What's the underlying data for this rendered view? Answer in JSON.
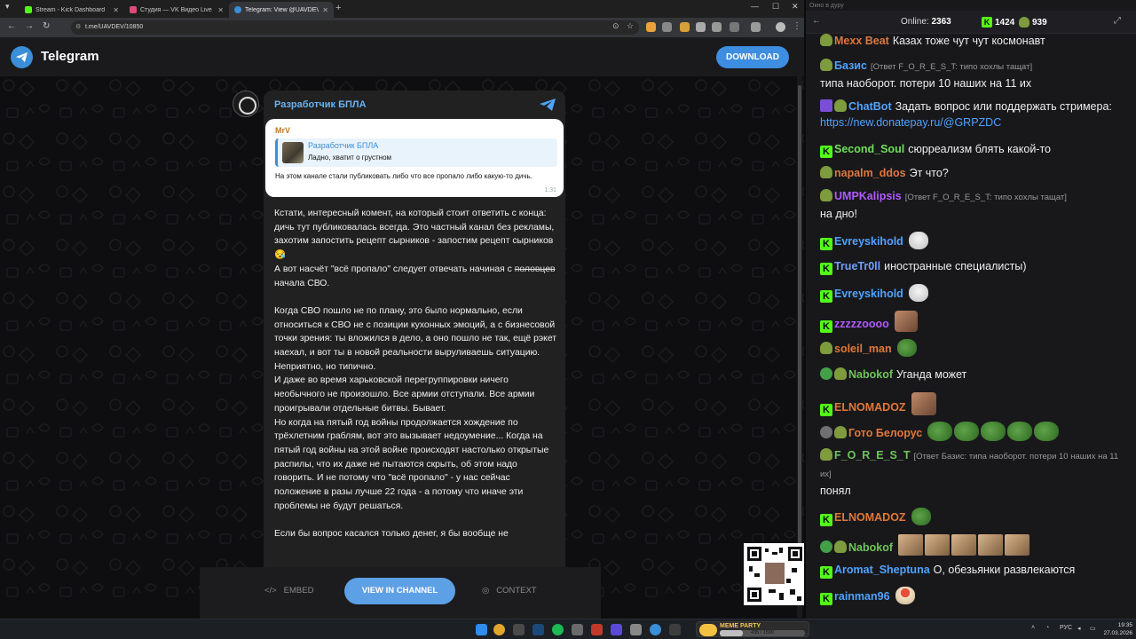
{
  "browser": {
    "tabs": [
      {
        "title": "Stream - Kick Dashboard",
        "color": "#53fc18"
      },
      {
        "title": "Студия — VK Видео Live",
        "color": "#e04a7a"
      },
      {
        "title": "Telegram: View @UAVDEV",
        "color": "#3a8fd8",
        "active": true
      }
    ],
    "new_tab_icon": "+",
    "url": "t.me/UAVDEV/10850"
  },
  "telegram": {
    "brand": "Telegram",
    "download_label": "DOWNLOAD",
    "channel_title": "Разработчик БПЛА",
    "forward": {
      "author": "MrV",
      "quote_title": "Разработчик БПЛА",
      "quote_text": "Ладно, хватит о грустном",
      "text": "На этом канале стали публиковать либо что все пропало либо какую-то дичь.",
      "time": "1:31"
    },
    "post": {
      "p1": "Кстати, интересный комент, на который стоит ответить с конца: дичь тут публиковалась всегда. Это частный канал без рекламы, захотим запостить рецепт сырников - запостим рецепт сырников 😪",
      "p2_before": "А вот насчёт \"всё пропало\" следует отвечать начиная с ",
      "p2_strike": "половцев",
      "p2_after": " начала СВО.",
      "p3": "Когда СВО пошло не по плану, это было нормально, если относиться к СВО не с позиции кухонных эмоций, а с бизнесовой точки зрения: ты вложился в дело, а оно пошло не так, ещё рэкет наехал, и вот ты в новой реальности выруливаешь ситуацию. Неприятно, но типично.",
      "p4": "И даже во время харьковской перегруппировки ничего необычного не произошло. Все армии отступали. Все армии проигрывали отдельные битвы. Бывает.",
      "p5": "Но когда на пятый год войны продолжается хождение по трёхлетним граблям, вот это вызывает недоумение... Когда на пятый год войны на этой войне происходят настолько открытые распилы, что их даже не пытаются скрыть, об этом надо говорить. И не потому что \"всё пропало\" - у нас сейчас положение в разы лучше 22 года - а потому что иначе эти проблемы не будут решаться.",
      "p6": "Если бы вопрос касался только денег, я бы вообще не"
    },
    "embed_label": "EMBED",
    "view_label": "VIEW IN CHANNEL",
    "context_label": "CONTEXT"
  },
  "chat": {
    "window_title": "Окно в дуру",
    "online_label": "Online:",
    "online_count": "2363",
    "stat1": "1424",
    "stat2": "939",
    "messages": [
      {
        "user": "Mexx Beat",
        "color": "#e0783a",
        "text": "Казах тоже чут чут космонавт"
      },
      {
        "user": "Базис",
        "color": "#4fa3ff",
        "reply": "[Ответ F_O_R_E_S_T: типо хохлы тащат]",
        "text": "типа наоборот. потери 10 наших на 11 их"
      },
      {
        "user": "ChatBot",
        "color": "#4fa3ff",
        "text": "Задать вопрос или поддержать стримера:",
        "link": "https://new.donatepay.ru/@GRPZDC"
      },
      {
        "user": "Second_Soul",
        "color": "#6fe05a",
        "text": "сюрреализм блять какой-то"
      },
      {
        "user": "napalm_ddos",
        "color": "#e0783a",
        "text": "Эт что?"
      },
      {
        "user": "UMPKalipsis",
        "color": "#b05aff",
        "reply": "[Ответ F_O_R_E_S_T: типо хохлы тащат]",
        "text": "на дно!"
      },
      {
        "user": "Evreyskihold",
        "color": "#4fa3ff",
        "text": ""
      },
      {
        "user": "TrueTr0ll",
        "color": "#6fa0ff",
        "text": "иностранные специалисты)"
      },
      {
        "user": "Evreyskihold",
        "color": "#4fa3ff",
        "text": ""
      },
      {
        "user": "zzzzzoooo",
        "color": "#b05aff",
        "text": ""
      },
      {
        "user": "soleil_man",
        "color": "#e0783a",
        "text": ""
      },
      {
        "user": "Nabokof",
        "color": "#6fc45a",
        "text": "Уганда может"
      },
      {
        "user": "ELNOMADOZ",
        "color": "#e0783a",
        "text": ""
      },
      {
        "user": "Гото Белорус",
        "color": "#e0783a",
        "text": ""
      },
      {
        "user": "F_O_R_E_S_T",
        "color": "#6fc45a",
        "reply": "[Ответ Базис: типа наоборот. потери 10 наших на 11 их]",
        "text": "понял"
      },
      {
        "user": "ELNOMADOZ",
        "color": "#e0783a",
        "text": ""
      },
      {
        "user": "Nabokof",
        "color": "#6fc45a",
        "text": ""
      },
      {
        "user": "Aromat_Sheptuna",
        "color": "#4fa3ff",
        "text": "О, обезьянки развлекаются"
      },
      {
        "user": "rainman96",
        "color": "#4fa3ff",
        "text": ""
      }
    ]
  },
  "taskbar": {
    "widget_title": "MEME PARTY",
    "widget_progress_text": "435 / 1590",
    "widget_progress": 0.27,
    "lang": "РУС",
    "time": "19:35",
    "date": "27.03.2026"
  }
}
